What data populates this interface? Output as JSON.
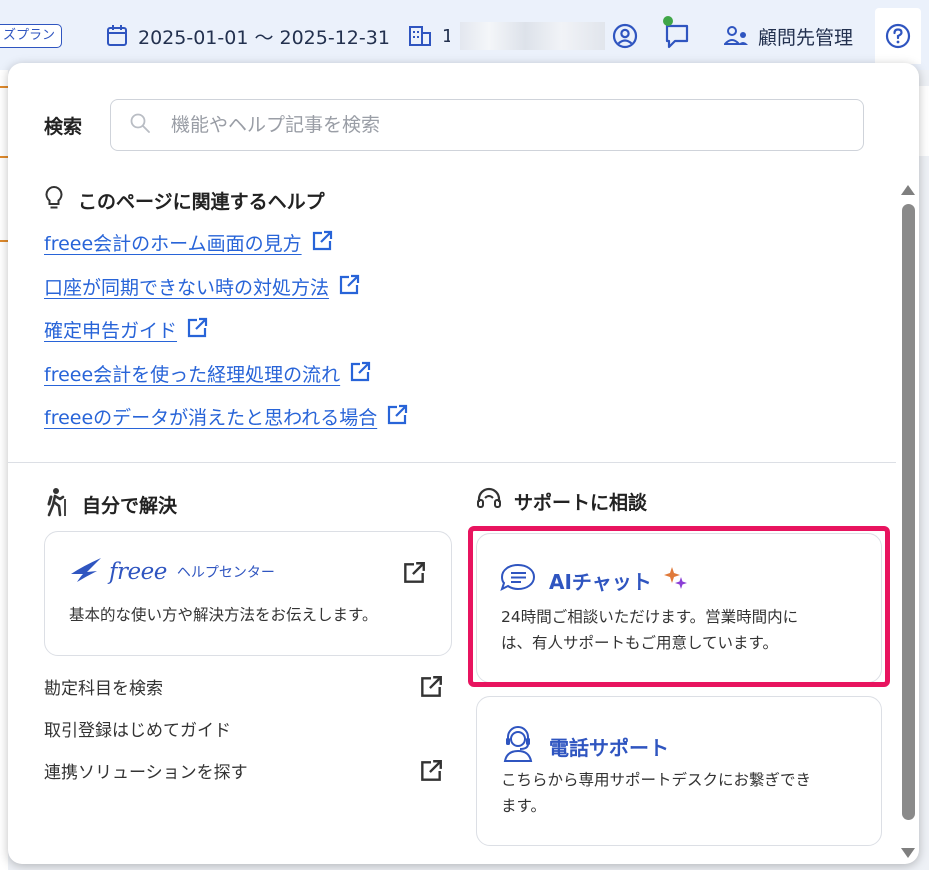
{
  "topbar": {
    "plan_badge": "ズプラン",
    "date_range": "2025-01-01 〜 2025-12-31",
    "office_char": "1",
    "clients_label": "顧問先管理",
    "icons": [
      "calendar-icon",
      "office-icon",
      "profile-icon",
      "chat-icon",
      "users-icon",
      "help-icon"
    ],
    "notification_color": "#3fa648"
  },
  "help_panel": {
    "search": {
      "label": "検索",
      "placeholder": "機能やヘルプ記事を検索",
      "value": ""
    },
    "related": {
      "title": "このページに関連するヘルプ",
      "links": [
        "freee会計のホーム画面の見方",
        "口座が同期できない時の対処方法",
        "確定申告ガイド",
        "freee会計を使った経理処理の流れ",
        "freeeのデータが消えたと思われる場合"
      ]
    },
    "self_solve": {
      "title": "自分で解決",
      "help_center": {
        "logo_word": "freee",
        "logo_sub": "ヘルプセンター",
        "desc": "基本的な使い方や解決方法をお伝えします。"
      },
      "tools": [
        {
          "label": "勘定科目を検索",
          "external": true
        },
        {
          "label": "取引登録はじめてガイド",
          "external": false
        },
        {
          "label": "連携ソリューションを探す",
          "external": true
        }
      ]
    },
    "support": {
      "title": "サポートに相談",
      "ai_chat": {
        "label": "AIチャット",
        "desc_line1": "24時間ご相談いただけます。営業時間内に",
        "desc_line2": "は、有人サポートもご用意しています。"
      },
      "phone": {
        "label": "電話サポート",
        "desc_line1": "こちらから専用サポートデスクにお繋ぎでき",
        "desc_line2": "ます。"
      }
    }
  },
  "colors": {
    "link": "#2864d8",
    "brand": "#2f55c0",
    "highlight": "#e8145f",
    "sparkle": "#8b3fd6"
  }
}
